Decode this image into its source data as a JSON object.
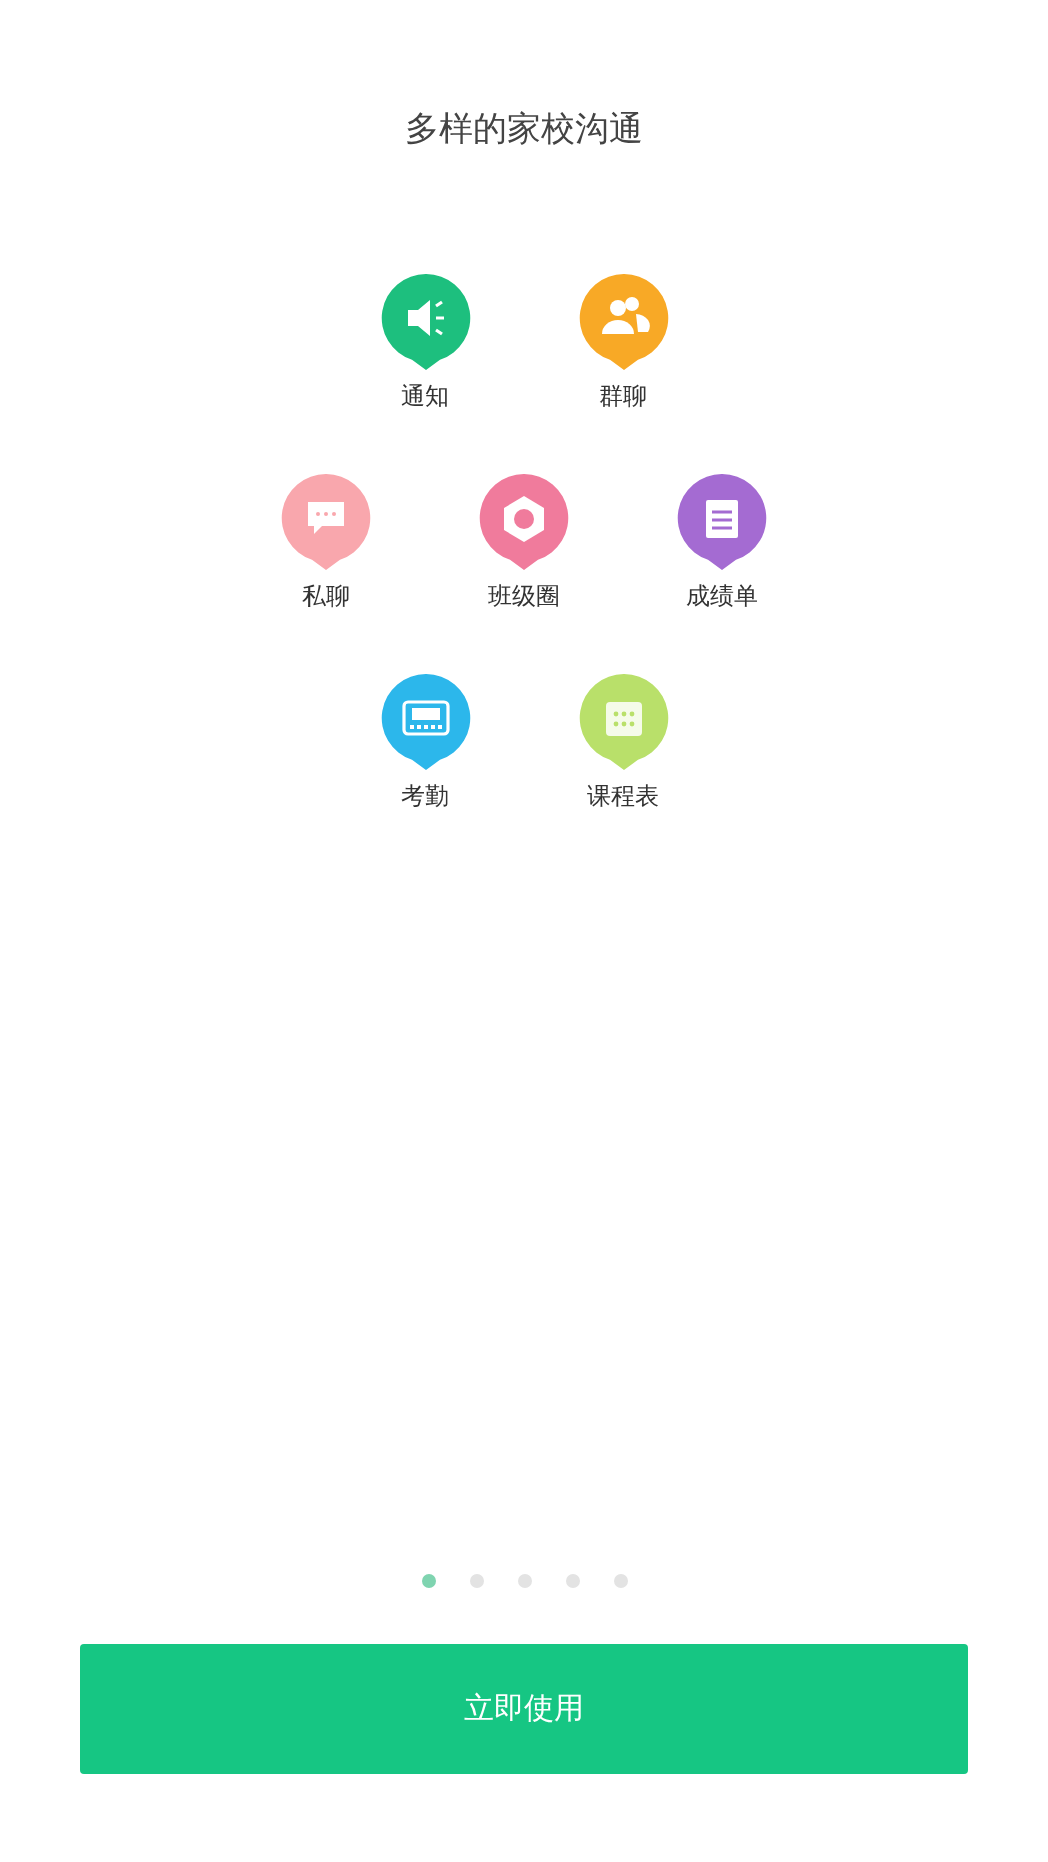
{
  "title": "多样的家校沟通",
  "feature_rows": [
    [
      {
        "label": "通知",
        "kind": "speaker",
        "color": "#1dbf7e"
      },
      {
        "label": "群聊",
        "kind": "group",
        "color": "#f8a926"
      }
    ],
    [
      {
        "label": "私聊",
        "kind": "chat",
        "color": "#f9a7ad"
      },
      {
        "label": "班级圈",
        "kind": "hexagon",
        "color": "#f07b9c"
      },
      {
        "label": "成绩单",
        "kind": "notepad",
        "color": "#a46bd2"
      }
    ],
    [
      {
        "label": "考勤",
        "kind": "clock",
        "color": "#2cb7eb"
      },
      {
        "label": "课程表",
        "kind": "calendar",
        "color": "#b9e06a"
      }
    ]
  ],
  "pager": [
    {
      "selected": true
    },
    {
      "selected": false
    },
    {
      "selected": false
    },
    {
      "selected": false
    },
    {
      "selected": false
    }
  ],
  "button": "立即使用"
}
